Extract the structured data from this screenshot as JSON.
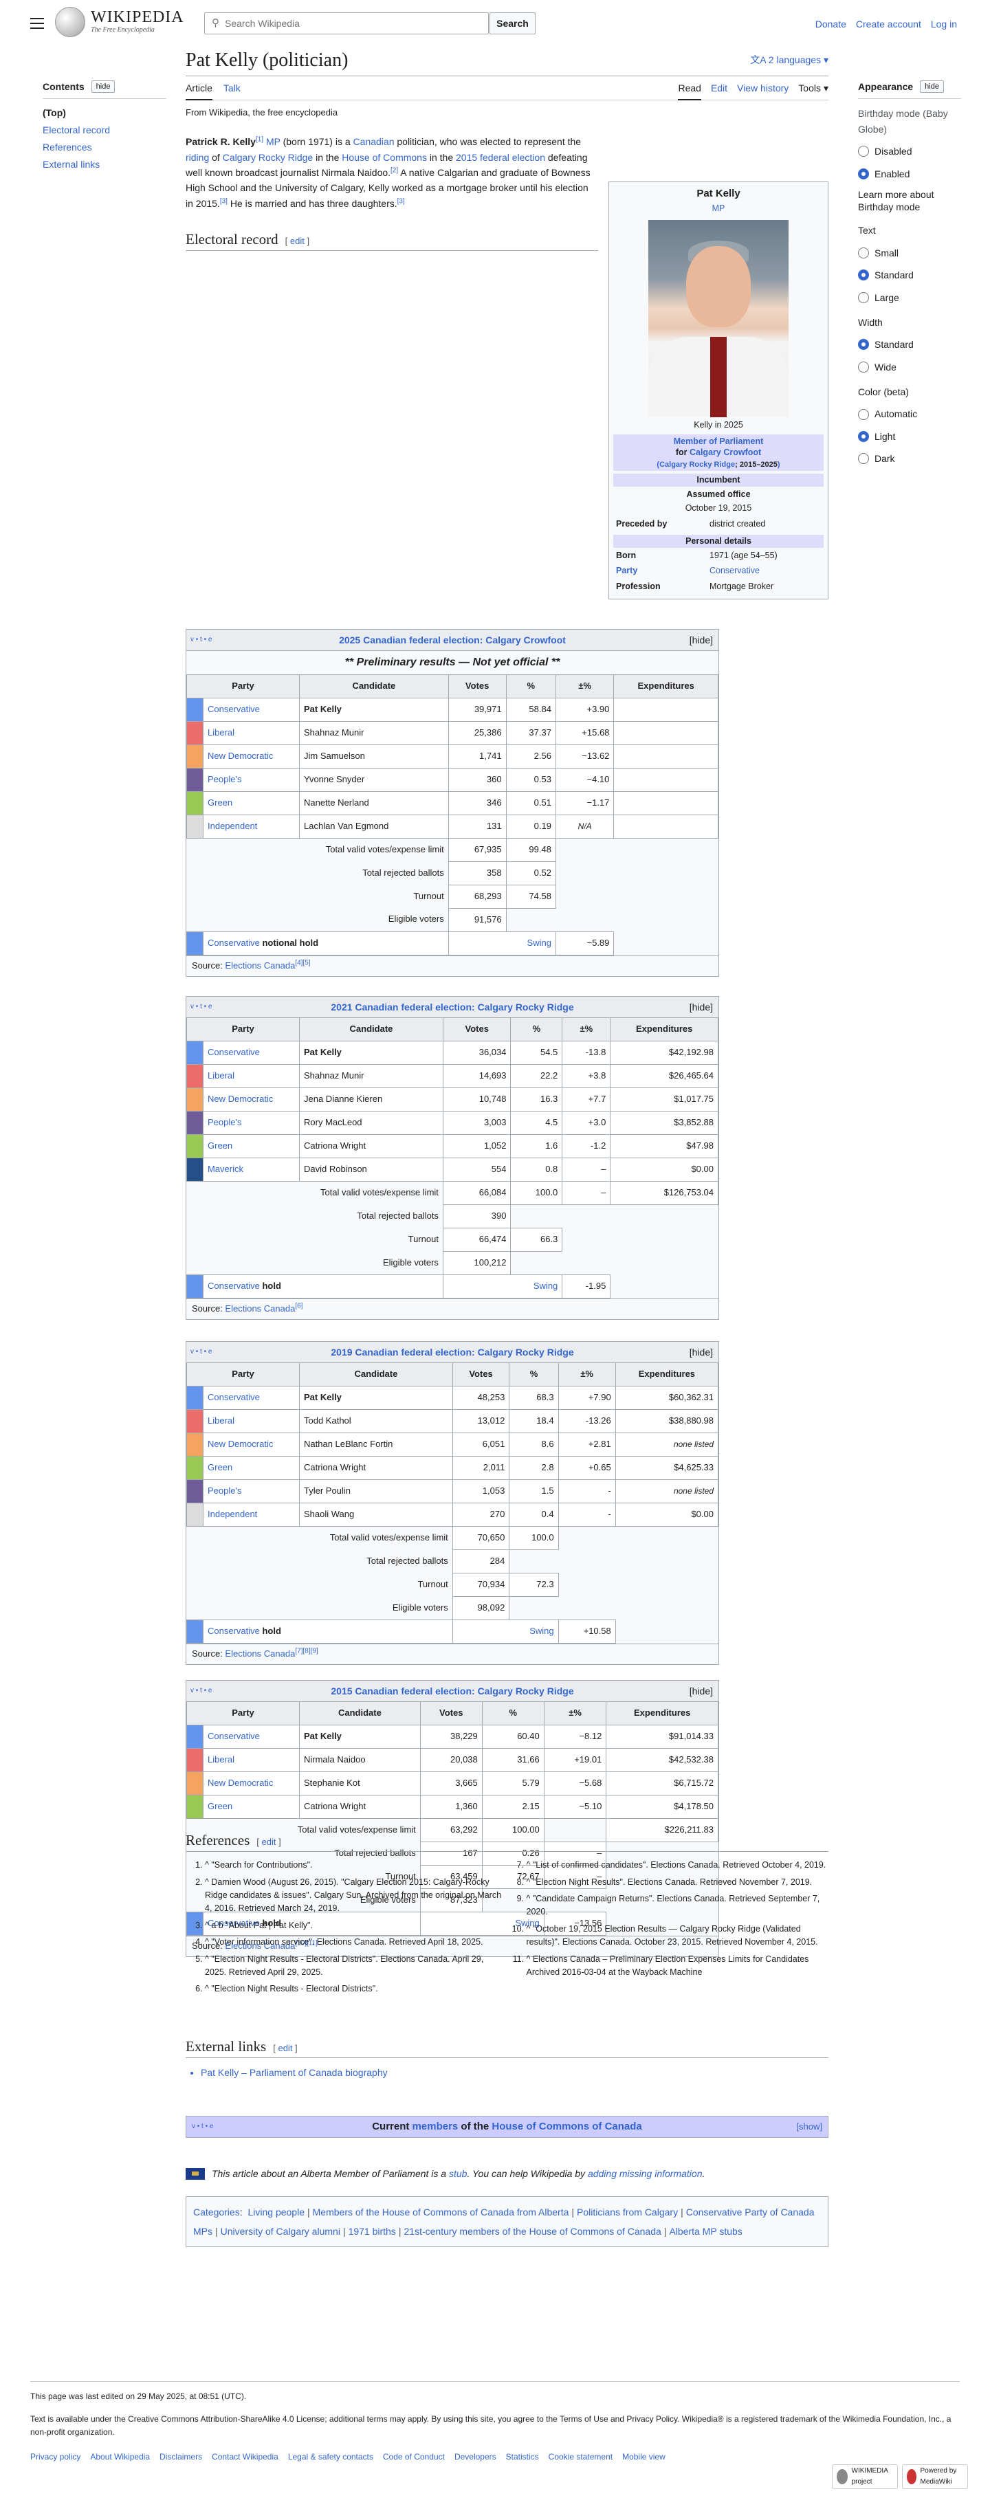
{
  "header": {
    "wordmark": "WIKIPEDIA",
    "tagline": "The Free Encyclopedia",
    "search_placeholder": "Search Wikipedia",
    "search_button": "Search",
    "links": [
      "Donate",
      "Create account",
      "Log in"
    ]
  },
  "toc": {
    "title": "Contents",
    "hide": "hide",
    "items": [
      "(Top)",
      "Electoral record",
      "References",
      "External links"
    ]
  },
  "article": {
    "title": "Pat Kelly (politician)",
    "languages": "2 languages",
    "tabs_left": [
      "Article",
      "Talk"
    ],
    "tabs_right": [
      "Read",
      "Edit",
      "View history",
      "Tools"
    ],
    "from": "From Wikipedia, the free encyclopedia",
    "intro": {
      "name": "Patrick R. Kelly",
      "s1": " (born 1971) is a ",
      "canadian": "Canadian",
      "s2": " politician, who was elected to represent the ",
      "riding": "riding",
      "s3": " of ",
      "crr": "Calgary Rocky Ridge",
      "s4": " in the ",
      "hoc": "House of Commons",
      "s5": " in the ",
      "elec": "2015 federal election",
      "s6": " defeating well known broadcast journalist Nirmala Naidoo.",
      "s7": " A native Calgarian and graduate of Bowness High School and the University of Calgary, Kelly worked as a mortgage broker until his election in 2015.",
      "s8": " He is married and has three daughters.",
      "r1": "[1]",
      "r2": "[2]",
      "r3": "[3]",
      "mp": "MP"
    },
    "electoral_heading": "Electoral record",
    "edit": "edit"
  },
  "infobox": {
    "name": "Pat Kelly",
    "mp": "MP",
    "caption": "Kelly in 2025",
    "office": "Member of Parliament",
    "for": "for",
    "riding": "Calgary Crowfoot",
    "riding2": "Calgary Rocky Ridge",
    "years": "; 2015–2025",
    "incumbent": "Incumbent",
    "assumed_label": "Assumed office",
    "assumed": "October 19, 2015",
    "preceded_label": "Preceded by",
    "preceded": "district created",
    "personal": "Personal details",
    "born_label": "Born",
    "born": "1971 (age 54–55)",
    "party_label": "Party",
    "party": "Conservative",
    "prof_label": "Profession",
    "prof": "Mortgage Broker"
  },
  "elections": [
    {
      "title": "2025 Canadian federal election: Calgary Crowfoot",
      "prelim": "** Preliminary results — Not yet official **",
      "expend": false,
      "rows": [
        [
          "Conservative",
          "#6495ED",
          "Pat Kelly",
          "39,971",
          "58.84",
          "+3.90",
          ""
        ],
        [
          "Liberal",
          "#EA6D6A",
          "Shahnaz Munir",
          "25,386",
          "37.37",
          "+15.68",
          ""
        ],
        [
          "New Democratic",
          "#F4A460",
          "Jim Samuelson",
          "1,741",
          "2.56",
          "−13.62",
          ""
        ],
        [
          "People's",
          "#6F5D9A",
          "Yvonne Snyder",
          "360",
          "0.53",
          "−4.10",
          ""
        ],
        [
          "Green",
          "#99C955",
          "Nanette Nerland",
          "346",
          "0.51",
          "−1.17",
          ""
        ],
        [
          "Independent",
          "#DCDCDC",
          "Lachlan Van Egmond",
          "131",
          "0.19",
          "N/A",
          ""
        ]
      ],
      "totals": [
        [
          "Total valid votes/expense limit",
          "67,935",
          "99.48",
          "",
          ""
        ],
        [
          "Total rejected ballots",
          "358",
          "0.52",
          "",
          ""
        ],
        [
          "Turnout",
          "68,293",
          "74.58",
          "",
          ""
        ],
        [
          "Eligible voters",
          "91,576",
          "",
          "",
          ""
        ]
      ],
      "hold": {
        "party": "Conservative",
        "text": " notional hold",
        "swing": "Swing",
        "val": "−5.89"
      },
      "source": "Elections Canada",
      "srcref": "[4][5]"
    },
    {
      "title": "2021 Canadian federal election: Calgary Rocky Ridge",
      "prelim": "",
      "expend": true,
      "rows": [
        [
          "Conservative",
          "#6495ED",
          "Pat Kelly",
          "36,034",
          "54.5",
          "-13.8",
          "$42,192.98"
        ],
        [
          "Liberal",
          "#EA6D6A",
          "Shahnaz Munir",
          "14,693",
          "22.2",
          "+3.8",
          "$26,465.64"
        ],
        [
          "New Democratic",
          "#F4A460",
          "Jena Dianne Kieren",
          "10,748",
          "16.3",
          "+7.7",
          "$1,017.75"
        ],
        [
          "People's",
          "#6F5D9A",
          "Rory MacLeod",
          "3,003",
          "4.5",
          "+3.0",
          "$3,852.88"
        ],
        [
          "Green",
          "#99C955",
          "Catriona Wright",
          "1,052",
          "1.6",
          "-1.2",
          "$47.98"
        ],
        [
          "Maverick",
          "#244F87",
          "David Robinson",
          "554",
          "0.8",
          "–",
          "$0.00"
        ]
      ],
      "totals": [
        [
          "Total valid votes/expense limit",
          "66,084",
          "100.0",
          "–",
          "$126,753.04"
        ],
        [
          "Total rejected ballots",
          "390",
          "",
          "",
          ""
        ],
        [
          "Turnout",
          "66,474",
          "66.3",
          "",
          ""
        ],
        [
          "Eligible voters",
          "100,212",
          "",
          "",
          ""
        ]
      ],
      "hold": {
        "party": "Conservative",
        "text": " hold",
        "swing": "Swing",
        "val": "-1.95"
      },
      "source": "Elections Canada",
      "srcref": "[6]"
    },
    {
      "title": "2019 Canadian federal election: Calgary Rocky Ridge",
      "prelim": "",
      "expend": true,
      "rows": [
        [
          "Conservative",
          "#6495ED",
          "Pat Kelly",
          "48,253",
          "68.3",
          "+7.90",
          "$60,362.31"
        ],
        [
          "Liberal",
          "#EA6D6A",
          "Todd Kathol",
          "13,012",
          "18.4",
          "-13.26",
          "$38,880.98"
        ],
        [
          "New Democratic",
          "#F4A460",
          "Nathan LeBlanc Fortin",
          "6,051",
          "8.6",
          "+2.81",
          "none listed"
        ],
        [
          "Green",
          "#99C955",
          "Catriona Wright",
          "2,011",
          "2.8",
          "+0.65",
          "$4,625.33"
        ],
        [
          "People's",
          "#6F5D9A",
          "Tyler Poulin",
          "1,053",
          "1.5",
          "-",
          "none listed"
        ],
        [
          "Independent",
          "#DCDCDC",
          "Shaoli Wang",
          "270",
          "0.4",
          "-",
          "$0.00"
        ]
      ],
      "totals": [
        [
          "Total valid votes/expense limit",
          "70,650",
          "100.0",
          "",
          ""
        ],
        [
          "Total rejected ballots",
          "284",
          "",
          "",
          ""
        ],
        [
          "Turnout",
          "70,934",
          "72.3",
          "",
          ""
        ],
        [
          "Eligible voters",
          "98,092",
          "",
          "",
          ""
        ]
      ],
      "hold": {
        "party": "Conservative",
        "text": " hold",
        "swing": "Swing",
        "val": "+10.58"
      },
      "source": "Elections Canada",
      "srcref": "[7][8][9]"
    },
    {
      "title": "2015 Canadian federal election: Calgary Rocky Ridge",
      "prelim": "",
      "expend": true,
      "rows": [
        [
          "Conservative",
          "#6495ED",
          "Pat Kelly",
          "38,229",
          "60.40",
          "−8.12",
          "$91,014.33"
        ],
        [
          "Liberal",
          "#EA6D6A",
          "Nirmala Naidoo",
          "20,038",
          "31.66",
          "+19.01",
          "$42,532.38"
        ],
        [
          "New Democratic",
          "#F4A460",
          "Stephanie Kot",
          "3,665",
          "5.79",
          "−5.68",
          "$6,715.72"
        ],
        [
          "Green",
          "#99C955",
          "Catriona Wright",
          "1,360",
          "2.15",
          "−5.10",
          "$4,178.50"
        ]
      ],
      "totals": [
        [
          "Total valid votes/expense limit",
          "63,292",
          "100.00",
          "",
          "$226,211.83"
        ],
        [
          "Total rejected ballots",
          "167",
          "0.26",
          "–",
          ""
        ],
        [
          "Turnout",
          "63,459",
          "72.67",
          "–",
          ""
        ],
        [
          "Eligible voters",
          "87,323",
          "",
          "",
          ""
        ]
      ],
      "hold": {
        "party": "Conservative",
        "text": " hold",
        "swing": "Swing",
        "val": "−13.56"
      },
      "source": "Elections Canada",
      "srcref": "[10][11]"
    }
  ],
  "cols": [
    "Party",
    "Candidate",
    "Votes",
    "%",
    "±%",
    "Expenditures"
  ],
  "vte": "v • t • e",
  "hide": "[hide]",
  "source_label": "Source: ",
  "references": {
    "heading": "References",
    "left": [
      "^ \"Search for Contributions\".",
      "^ Damien Wood (August 26, 2015). \"Calgary Election 2015: Calgary-Rocky Ridge candidates & issues\". Calgary Sun. Archived from the original on March 4, 2016. Retrieved March 24, 2019.",
      "^ a b \"About Pat | Pat Kelly\".",
      "^ \"Voter information service\". Elections Canada. Retrieved April 18, 2025.",
      "^ \"Election Night Results - Electoral Districts\". Elections Canada. April 29, 2025. Retrieved April 29, 2025.",
      "^ \"Election Night Results - Electoral Districts\"."
    ],
    "right": [
      "^ \"List of confirmed candidates\". Elections Canada. Retrieved October 4, 2019.",
      "^ \"Election Night Results\". Elections Canada. Retrieved November 7, 2019.",
      "^ \"Candidate Campaign Returns\". Elections Canada. Retrieved September 7, 2020.",
      "^ \"October 19, 2015 Election Results — Calgary Rocky Ridge (Validated results)\". Elections Canada. October 23, 2015. Retrieved November 4, 2015.",
      "^ Elections Canada – Preliminary Election Expenses Limits for Candidates Archived 2016-03-04 at the Wayback Machine"
    ]
  },
  "external": {
    "heading": "External links",
    "item": "Pat Kelly – Parliament of Canada biography"
  },
  "navbox": {
    "vte": "v • t • e",
    "pre": "Current ",
    "members": "members",
    "mid": " of the ",
    "hoc": "House of Commons of Canada",
    "show": "[show]"
  },
  "stub": {
    "a": "This article about an Alberta Member of Parliament is a ",
    "stub": "stub",
    "b": ". You can help Wikipedia by ",
    "add": "adding missing information",
    "c": "."
  },
  "categories": {
    "label": "Categories",
    "items": [
      "Living people",
      "Members of the House of Commons of Canada from Alberta",
      "Politicians from Calgary",
      "Conservative Party of Canada MPs",
      "University of Calgary alumni",
      "1971 births",
      "21st-century members of the House of Commons of Canada",
      "Alberta MP stubs"
    ]
  },
  "appearance": {
    "title": "Appearance",
    "hide": "hide",
    "birthday": "Birthday mode (Baby Globe)",
    "birthday_opts": [
      "Disabled",
      "Enabled"
    ],
    "learn": "Learn more about Birthday mode",
    "text": "Text",
    "text_opts": [
      "Small",
      "Standard",
      "Large"
    ],
    "width": "Width",
    "width_opts": [
      "Standard",
      "Wide"
    ],
    "color": "Color (beta)",
    "color_opts": [
      "Automatic",
      "Light",
      "Dark"
    ]
  },
  "footer": {
    "edited": "This page was last edited on 29 May 2025, at 08:51 (UTC).",
    "license": "Text is available under the Creative Commons Attribution-ShareAlike 4.0 License; additional terms may apply. By using this site, you agree to the Terms of Use and Privacy Policy. Wikipedia® is a registered trademark of the Wikimedia Foundation, Inc., a non-profit organization.",
    "links": [
      "Privacy policy",
      "About Wikipedia",
      "Disclaimers",
      "Contact Wikipedia",
      "Legal & safety contacts",
      "Code of Conduct",
      "Developers",
      "Statistics",
      "Cookie statement",
      "Mobile view"
    ],
    "badge1": "WIKIMEDIA project",
    "badge2": "Powered by MediaWiki"
  }
}
